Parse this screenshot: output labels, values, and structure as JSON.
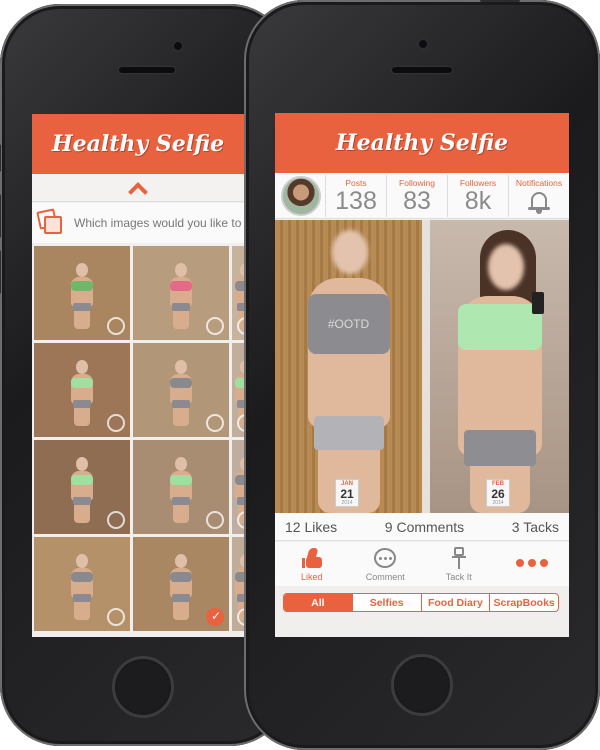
{
  "app": {
    "title": "Healthy Selfie",
    "accent_color": "#e8623f"
  },
  "left_phone": {
    "collapse_icon": "chevron-up-icon",
    "prompt_icon": "photo-stack-icon",
    "prompt_text": "Which images would you like to",
    "photos": [
      {
        "top_color": "#6fb86a",
        "selected": false
      },
      {
        "top_color": "#e46a8a",
        "selected": false
      },
      {
        "top_color": "#8a8a8e",
        "selected": false
      },
      {
        "top_color": "#9de0a0",
        "selected": false
      },
      {
        "top_color": "#8a8a8e",
        "selected": false
      },
      {
        "top_color": "#9de0a0",
        "selected": false
      },
      {
        "top_color": "#9de0a0",
        "selected": false
      },
      {
        "top_color": "#9de0a0",
        "selected": false
      },
      {
        "top_color": "#8a8a8e",
        "selected": false
      },
      {
        "top_color": "#8a8a8e",
        "selected": false
      },
      {
        "top_color": "#8a8a8e",
        "selected": true
      },
      {
        "top_color": "#8a8a8e",
        "selected": false
      }
    ]
  },
  "right_phone": {
    "stats": [
      {
        "label": "Posts",
        "value": "138"
      },
      {
        "label": "Following",
        "value": "83"
      },
      {
        "label": "Followers",
        "value": "8k"
      }
    ],
    "notifications_label": "Notifications",
    "photo_text": "#OOTD",
    "dates": [
      {
        "month": "JAN",
        "day": "21",
        "year": "2014"
      },
      {
        "month": "FEB",
        "day": "26",
        "year": "2014"
      }
    ],
    "counts": {
      "likes": "12 Likes",
      "comments": "9 Comments",
      "tacks": "3 Tacks"
    },
    "actions": [
      {
        "label": "Liked",
        "icon": "thumbs-up-icon",
        "active": true
      },
      {
        "label": "Comment",
        "icon": "comment-bubble-icon",
        "active": false
      },
      {
        "label": "Tack It",
        "icon": "pushpin-icon",
        "active": false
      },
      {
        "label": "",
        "icon": "more-dots-icon",
        "active": false
      }
    ],
    "tabs": [
      {
        "label": "All",
        "active": true
      },
      {
        "label": "Selfies",
        "active": false
      },
      {
        "label": "Food Diary",
        "active": false
      },
      {
        "label": "ScrapBooks",
        "active": false
      }
    ]
  }
}
